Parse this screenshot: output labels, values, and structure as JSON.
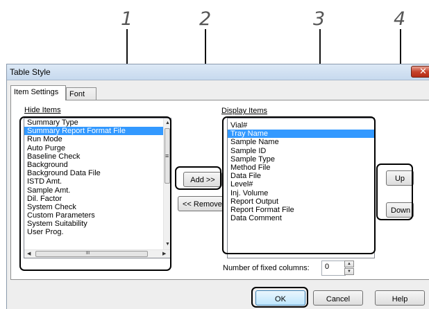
{
  "callouts": [
    "1",
    "2",
    "3",
    "4"
  ],
  "dialog": {
    "title": "Table Style",
    "close_glyph": "✕"
  },
  "tabs": [
    {
      "label": "Item Settings",
      "active": true
    },
    {
      "label": "Font",
      "active": false
    }
  ],
  "hide_items": {
    "label": "Hide Items",
    "items": [
      "Summary Type",
      "Summary Report Format File",
      "Run Mode",
      "Auto Purge",
      "Baseline Check",
      "Background",
      "Background Data File",
      "ISTD Amt.",
      "Sample Amt.",
      "Dil. Factor",
      "System Check",
      "Custom Parameters",
      "System Suitability",
      "User Prog."
    ],
    "selected_index": 1
  },
  "display_items": {
    "label": "Display Items",
    "items": [
      "Vial#",
      "Tray Name",
      "Sample Name",
      "Sample ID",
      "Sample Type",
      "Method File",
      "Data File",
      "Level#",
      "Inj. Volume",
      "Report Output",
      "Report Format File",
      "Data Comment"
    ],
    "selected_index": 1
  },
  "buttons": {
    "add": "Add >>",
    "remove": "<< Remove",
    "up": "Up",
    "down": "Down",
    "ok": "OK",
    "cancel": "Cancel",
    "help": "Help"
  },
  "fixed_columns": {
    "label": "Number of fixed columns:",
    "value": "0"
  },
  "scroll_glyphs": {
    "up": "▲",
    "down": "▼",
    "left": "◀",
    "right": "▶",
    "hgrip": "III",
    "vgrip": "≡"
  },
  "colors": {
    "selection": "#3399ff",
    "title_bar": "#c7d9ee",
    "close_button": "#c6432c"
  }
}
